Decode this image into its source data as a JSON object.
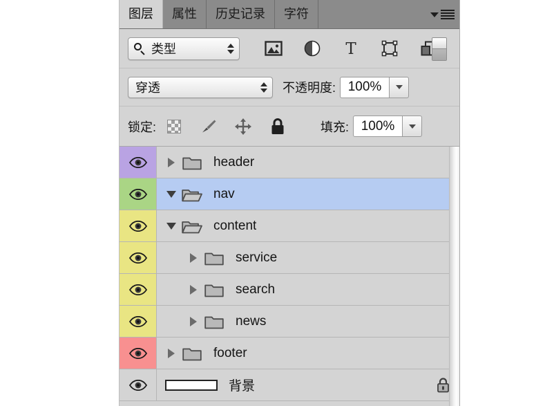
{
  "panel": {
    "tabs": [
      {
        "label": "图层",
        "active": true
      },
      {
        "label": "属性",
        "active": false
      },
      {
        "label": "历史记录",
        "active": false
      },
      {
        "label": "字符",
        "active": false
      }
    ],
    "menu_icon": "panel-menu-icon"
  },
  "filter_bar": {
    "kind_label": "类型",
    "search_icon": "search-icon",
    "icons": [
      {
        "name": "filter-pixel-icon",
        "title": "像素图层"
      },
      {
        "name": "filter-adjustment-icon",
        "title": "调整图层"
      },
      {
        "name": "filter-type-icon",
        "title": "文字图层"
      },
      {
        "name": "filter-shape-icon",
        "title": "形状图层"
      },
      {
        "name": "filter-smart-object-icon",
        "title": "智能对象"
      }
    ],
    "toggle_name": "filter-enable-toggle"
  },
  "blend_bar": {
    "mode": "穿透",
    "opacity_label": "不透明度:",
    "opacity_value": "100%"
  },
  "lock_bar": {
    "lock_label": "锁定:",
    "icons": [
      {
        "name": "lock-transparent-pixels-icon"
      },
      {
        "name": "lock-image-pixels-icon"
      },
      {
        "name": "lock-position-icon"
      },
      {
        "name": "lock-all-icon"
      }
    ],
    "fill_label": "填充:",
    "fill_value": "100%"
  },
  "layers": [
    {
      "name": "header",
      "type": "group",
      "expanded": false,
      "indent": 0,
      "selected": false,
      "visible": true,
      "color": "#b9a3e3",
      "locked": false
    },
    {
      "name": "nav",
      "type": "group",
      "expanded": true,
      "indent": 0,
      "selected": true,
      "visible": true,
      "color": "#aad585",
      "locked": false
    },
    {
      "name": "content",
      "type": "group",
      "expanded": true,
      "indent": 0,
      "selected": false,
      "visible": true,
      "color": "#e9e583",
      "locked": false
    },
    {
      "name": "service",
      "type": "group",
      "expanded": false,
      "indent": 1,
      "selected": false,
      "visible": true,
      "color": "#e9e583",
      "locked": false
    },
    {
      "name": "search",
      "type": "group",
      "expanded": false,
      "indent": 1,
      "selected": false,
      "visible": true,
      "color": "#e9e583",
      "locked": false
    },
    {
      "name": "news",
      "type": "group",
      "expanded": false,
      "indent": 1,
      "selected": false,
      "visible": true,
      "color": "#e9e583",
      "locked": false
    },
    {
      "name": "footer",
      "type": "group",
      "expanded": false,
      "indent": 0,
      "selected": false,
      "visible": true,
      "color": "#f89090",
      "locked": false
    },
    {
      "name": "背景",
      "type": "background",
      "expanded": false,
      "indent": 0,
      "selected": false,
      "visible": true,
      "color": "#d4d4d4",
      "locked": true
    }
  ],
  "colors": {
    "panel_bg": "#d4d4d4",
    "tab_bar": "#8b8b8b",
    "selection": "#b6ccf2",
    "row_divider": "#b5b5b5"
  }
}
